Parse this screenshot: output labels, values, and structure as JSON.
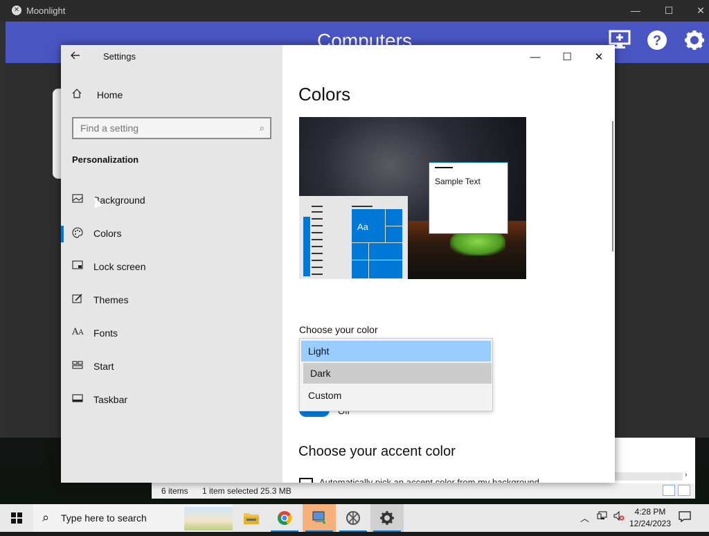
{
  "moonlight": {
    "title": "Moonlight",
    "header_title": "Computers",
    "add_pc_icon": "add-pc-icon",
    "help_icon": "help-icon",
    "settings_icon": "gear-icon",
    "header_color": "#4a55c4"
  },
  "settings": {
    "window_title": "Settings",
    "home_label": "Home",
    "search_placeholder": "Find a setting",
    "section_header": "Personalization",
    "nav_items": [
      {
        "label": "Background",
        "icon": "picture-icon"
      },
      {
        "label": "Colors",
        "icon": "palette-icon",
        "selected": true
      },
      {
        "label": "Lock screen",
        "icon": "lock-screen-icon"
      },
      {
        "label": "Themes",
        "icon": "themes-icon"
      },
      {
        "label": "Fonts",
        "icon": "fonts-icon"
      },
      {
        "label": "Start",
        "icon": "start-icon"
      },
      {
        "label": "Taskbar",
        "icon": "taskbar-icon"
      }
    ],
    "page_title": "Colors",
    "preview": {
      "sample_text": "Sample Text",
      "tile_label": "Aa"
    },
    "choose_color_label": "Choose your color",
    "color_options": [
      "Light",
      "Dark",
      "Custom"
    ],
    "color_selected": "Light",
    "toggle_state_text": "Off",
    "accent_title": "Choose your accent color",
    "auto_accent_text": "Automatically pick an accent color from my background",
    "accent_color": "#0078d7"
  },
  "explorer": {
    "items_count": "6 items",
    "selection_info": "1 item selected  25.3 MB"
  },
  "taskbar": {
    "search_placeholder": "Type here to search",
    "time": "4:28 PM",
    "date": "12/24/2023"
  }
}
